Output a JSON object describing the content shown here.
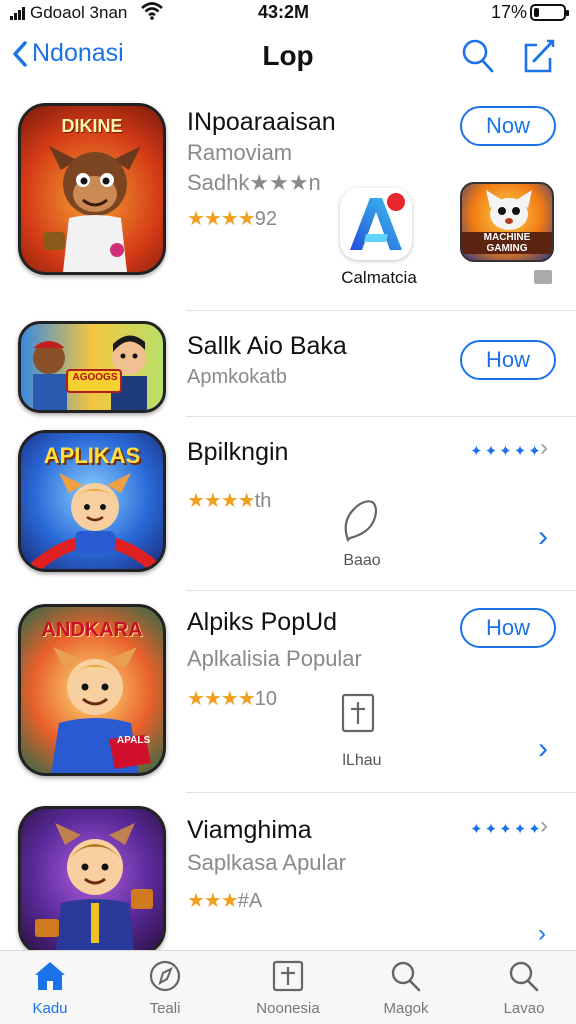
{
  "status_bar": {
    "carrier": "Gdoaol 3nan",
    "time": "43:2M",
    "battery_pct": "17%",
    "battery_level": 0.17
  },
  "nav": {
    "back_label": "Ndonasi",
    "title": "Lop",
    "search_icon": "search-icon",
    "compose_icon": "compose-icon"
  },
  "apps": [
    {
      "name": "INpoaraaisan",
      "subtitle": "Ramoviam",
      "subtitle2": "Sadhk★★★n",
      "stars": "★★★★",
      "rating_text": "92",
      "button": "Now",
      "icon_text": "DIKINE",
      "featured_label": "Calmatcia",
      "promo_text": "MACHINE GAMING"
    },
    {
      "name": "Sallk Aio Baka",
      "subtitle": "Apmkokatb",
      "button": "How",
      "icon_text": "AGOOGS"
    },
    {
      "name": "Bpilkngin",
      "stars": "★★★★",
      "rating_text": "th",
      "dots": "✦✦✦✦✦",
      "mini_label": "Baao",
      "icon_text": "APLIKAS"
    },
    {
      "name": "Alpiks PopUd",
      "subtitle": "Aplkalisia Popular",
      "stars": "★★★★",
      "rating_text": "10",
      "button": "How",
      "mini_label": "lLhau",
      "icon_text": "ANDKARA",
      "badge_text": "APALS"
    },
    {
      "name": "Viamghima",
      "subtitle": "Saplkasa Apular",
      "stars": "★★★",
      "rating_text": "#A",
      "dots": "✦✦✦✦✦"
    }
  ],
  "tabs": [
    {
      "label": "Kadu",
      "icon": "home-icon",
      "active": true
    },
    {
      "label": "Teali",
      "icon": "compass-icon",
      "active": false
    },
    {
      "label": "Noonesia",
      "icon": "book-icon",
      "active": false
    },
    {
      "label": "Magok",
      "icon": "search-icon",
      "active": false
    },
    {
      "label": "Lavao",
      "icon": "search-icon",
      "active": false
    }
  ],
  "colors": {
    "accent": "#1a73e8",
    "star": "#f0a020",
    "secondary_text": "#8a8a8a"
  }
}
